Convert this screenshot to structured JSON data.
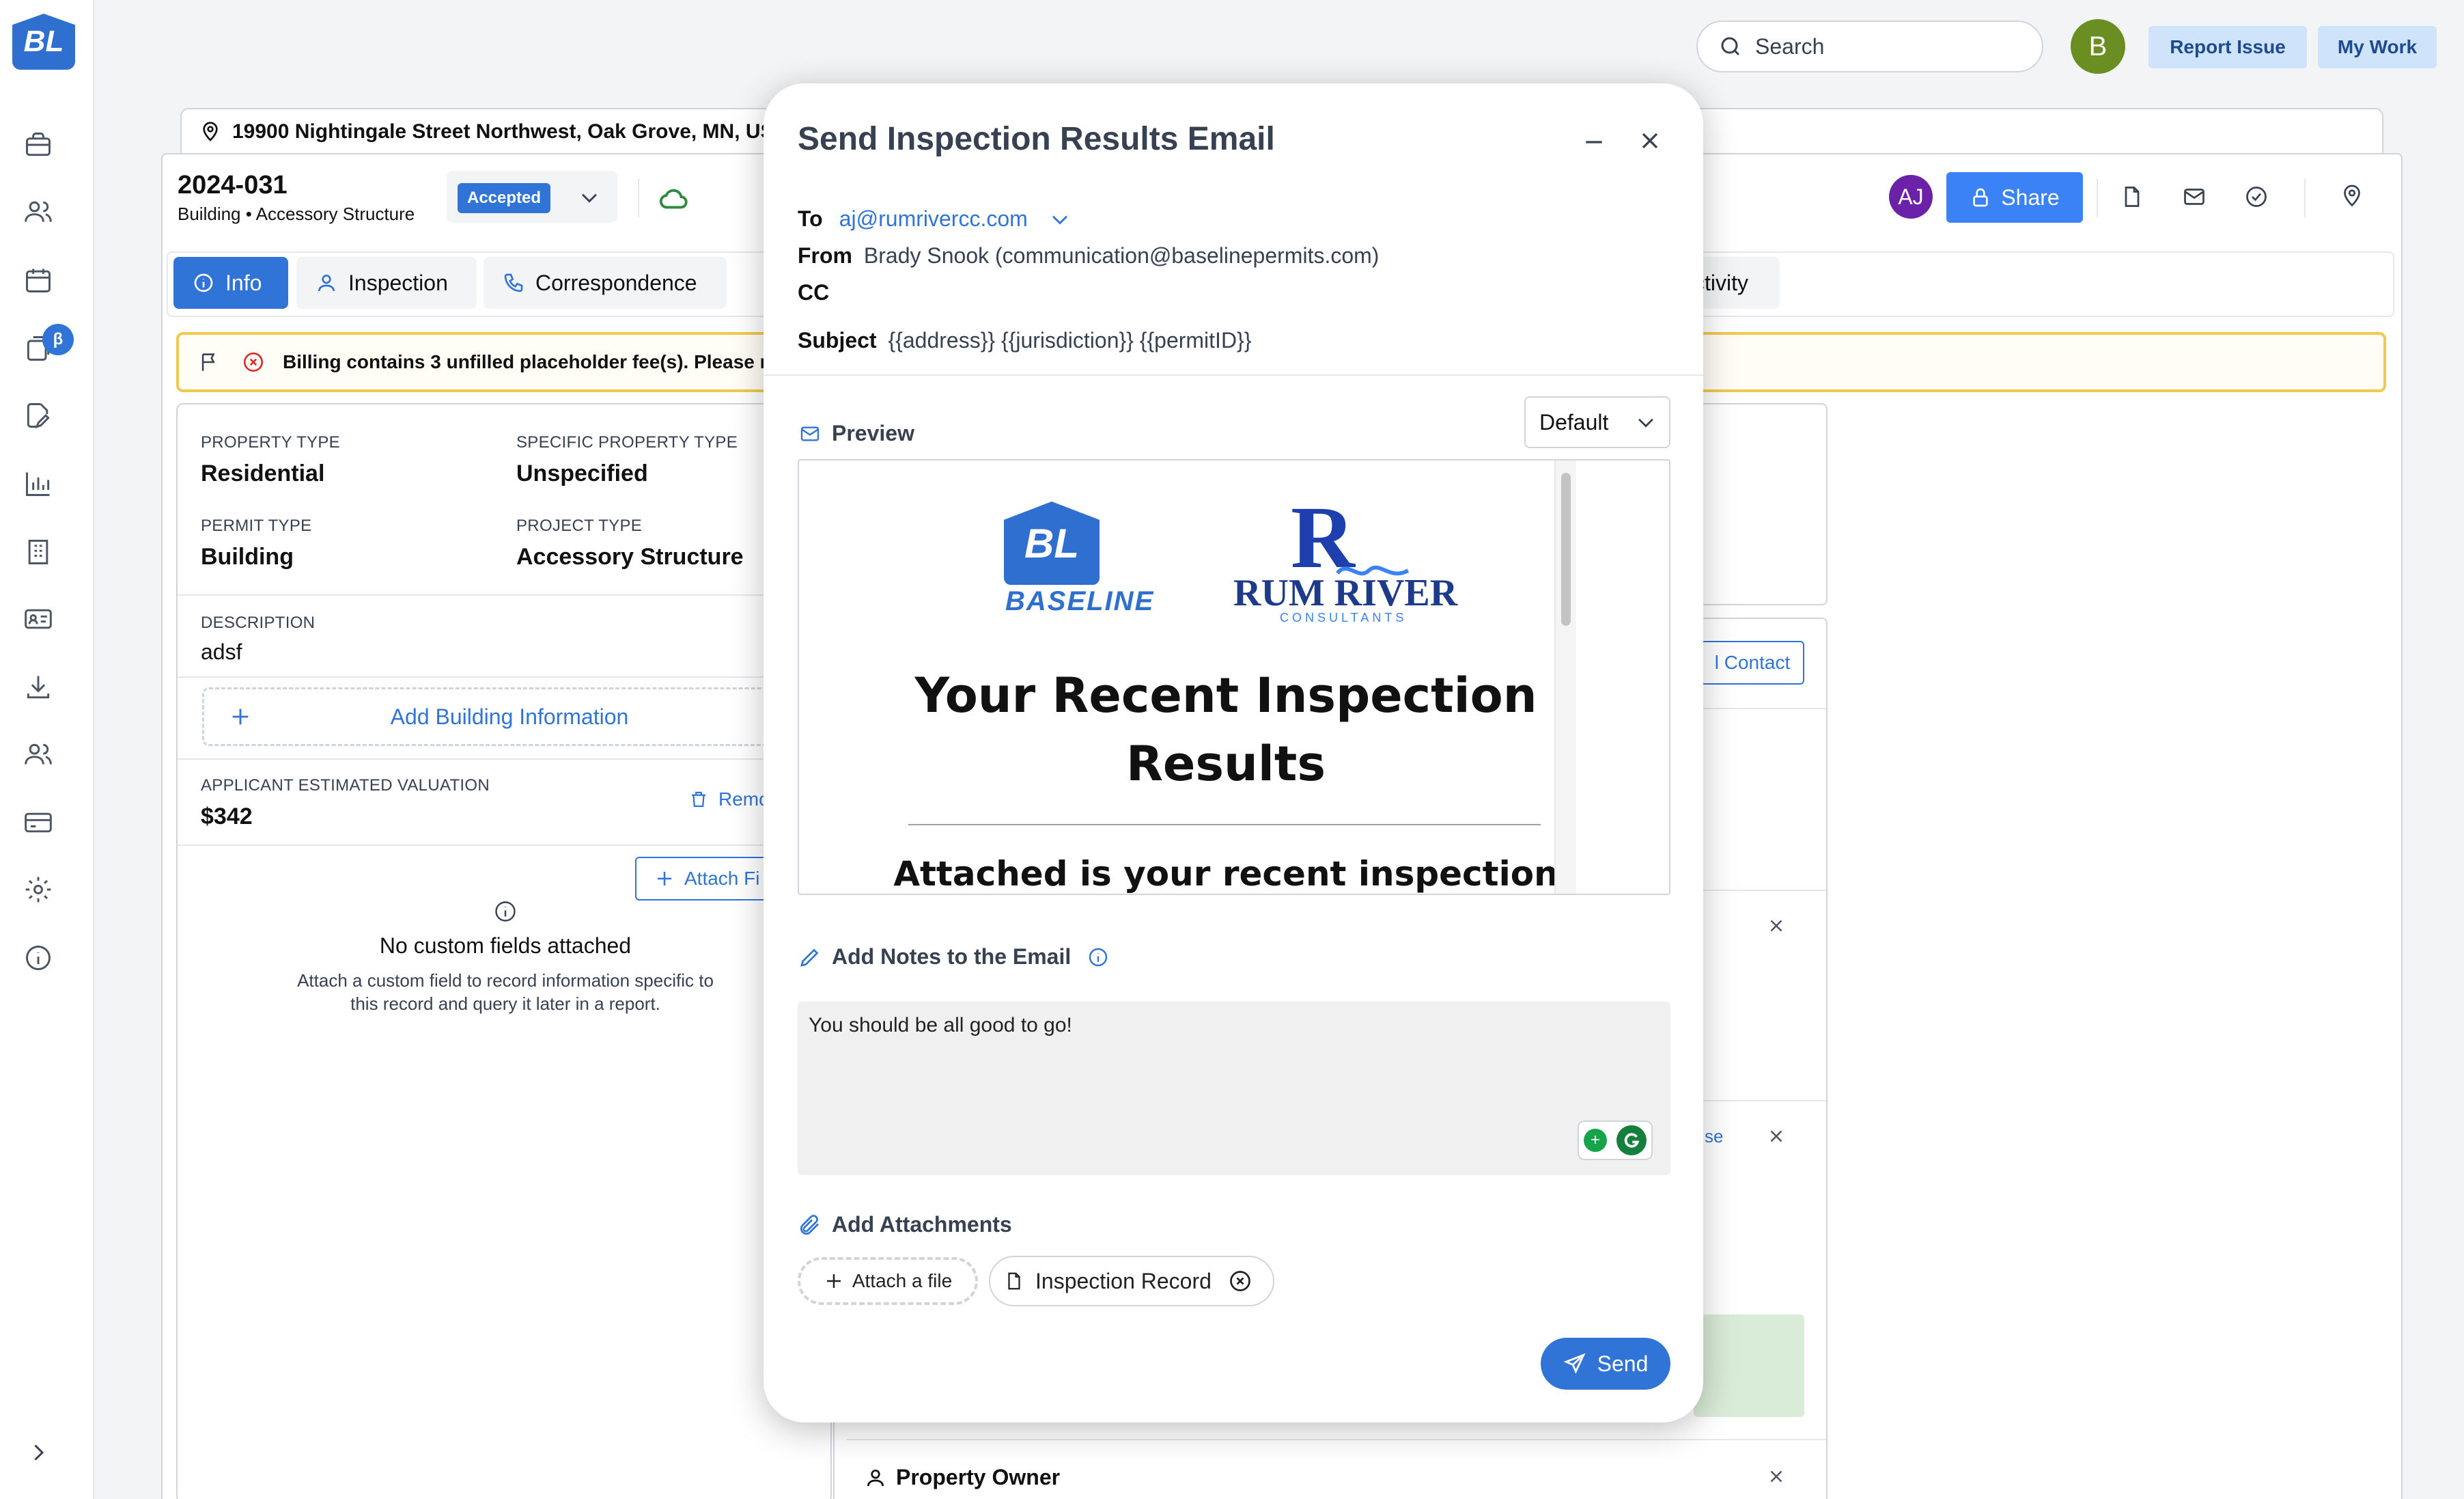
{
  "sidebar": {
    "logo_text": "BL",
    "beta_badge": "β",
    "icons": [
      "briefcase-icon",
      "people-icon",
      "calendar-icon",
      "permits-icon",
      "edit-doc-icon",
      "chart-icon",
      "building-icon",
      "id-card-icon",
      "download-icon",
      "users-icon",
      "credit-card-icon",
      "gear-icon",
      "info-icon"
    ]
  },
  "topbar": {
    "search_placeholder": "Search",
    "avatar_initial": "B",
    "report_issue": "Report Issue",
    "my_work": "My Work"
  },
  "record": {
    "address": "19900 Nightingale Street Northwest, Oak Grove, MN, USA",
    "id": "2024-031",
    "subtitle": "Building • Accessory Structure",
    "status": "Accepted",
    "share_avatar": "AJ",
    "share_label": "Share"
  },
  "tabs": [
    {
      "label": "Info"
    },
    {
      "label": "Inspection"
    },
    {
      "label": "Correspondence"
    },
    {
      "label": "ctivity"
    }
  ],
  "warning": {
    "text": "Billing contains 3 unfilled placeholder fee(s). Please rev"
  },
  "info": {
    "property_type_label": "PROPERTY TYPE",
    "property_type": "Residential",
    "specific_property_type_label": "SPECIFIC PROPERTY TYPE",
    "specific_property_type": "Unspecified",
    "permit_type_label": "PERMIT TYPE",
    "permit_type": "Building",
    "project_type_label": "PROJECT TYPE",
    "project_type": "Accessory Structure",
    "description_label": "DESCRIPTION",
    "description": "adsf",
    "add_building": "Add Building Information",
    "valuation_label": "APPLICANT ESTIMATED VALUATION",
    "valuation": "$342",
    "remove": "Remo",
    "attach_field": "Attach Fi",
    "no_custom_title": "No custom fields attached",
    "no_custom_line1": "Attach a custom field to record information specific to",
    "no_custom_line2": "this record and query it later in a report."
  },
  "right": {
    "contact_btn": "l Contact",
    "se_link": "se",
    "property_owner": "Property Owner"
  },
  "modal": {
    "title": "Send Inspection Results Email",
    "to_label": "To",
    "to_value": "aj@rumrivercc.com",
    "from_label": "From",
    "from_value": "Brady Snook (communication@baselinepermits.com)",
    "cc_label": "CC",
    "subject_label": "Subject",
    "subject_value": "{{address}} {{jurisdiction}} {{permitID}}",
    "preview_label": "Preview",
    "template_select": "Default",
    "preview": {
      "baseline_logo_text": "BL",
      "baseline_wordmark": "BASELINE",
      "rumriver_mark": "R",
      "rumriver_name": "RUM RIVER",
      "rumriver_sub": "CONSULTANTS",
      "heading_line1": "Your Recent Inspection",
      "heading_line2": "Results",
      "body_start": "Attached is your recent inspection"
    },
    "notes_label": "Add Notes to the Email",
    "notes_value": "You should be all good to go!",
    "attachments_label": "Add Attachments",
    "attach_file": "Attach a file",
    "attachment_name": "Inspection Record",
    "send": "Send"
  }
}
